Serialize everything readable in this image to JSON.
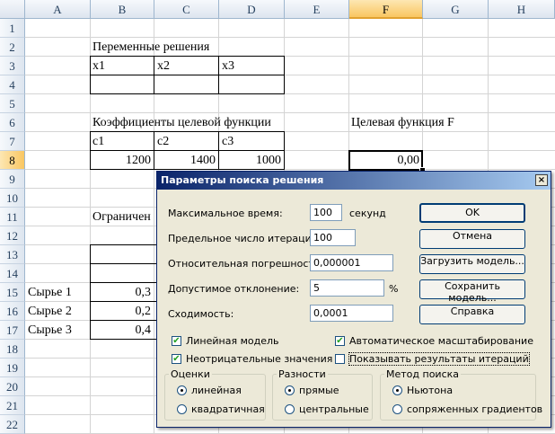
{
  "columns": [
    "A",
    "B",
    "C",
    "D",
    "E",
    "F",
    "G",
    "H"
  ],
  "rows": [
    "1",
    "2",
    "3",
    "4",
    "5",
    "6",
    "7",
    "8",
    "9",
    "10",
    "11",
    "12",
    "13",
    "14",
    "15",
    "16",
    "17",
    "18",
    "19",
    "20",
    "21",
    "22"
  ],
  "cells": {
    "b2": "Переменные решения",
    "b3": "x1",
    "c3": "x2",
    "d3": "x3",
    "b6": "Коэффициенты целевой функции",
    "f6": "Целевая функция F",
    "b7": "c1",
    "c7": "c2",
    "d7": "c3",
    "b8": "1200",
    "c8": "1400",
    "d8": "1000",
    "f8": "0,00",
    "b11": "Ограничен",
    "a15": "Сырье 1",
    "b15": "0,3",
    "a16": "Сырье 2",
    "b16": "0,2",
    "a17": "Сырье 3",
    "b17": "0,4"
  },
  "dialog": {
    "title": "Параметры поиска решения",
    "close_glyph": "×",
    "max_time_label": "Максимальное время:",
    "max_time_value": "100",
    "max_time_unit": "секунд",
    "iterations_label": "Предельное число итераций:",
    "iterations_value": "100",
    "precision_label": "Относительная погрешность:",
    "precision_value": "0,000001",
    "tolerance_label": "Допустимое отклонение:",
    "tolerance_value": "5",
    "tolerance_unit": "%",
    "convergence_label": "Сходимость:",
    "convergence_value": "0,0001",
    "buttons": {
      "ok": "OK",
      "cancel": "Отмена",
      "load": "Загрузить модель...",
      "save": "Сохранить модель...",
      "help": "Справка"
    },
    "checks": {
      "linear": "Линейная модель",
      "nonneg": "Неотрицательные значения",
      "autoscale": "Автоматическое масштабирование",
      "show_iter": "Показывать результаты итераций"
    },
    "estimates": {
      "title": "Оценки",
      "opt1": "линейная",
      "opt2": "квадратичная"
    },
    "derivatives": {
      "title": "Разности",
      "opt1": "прямые",
      "opt2": "центральные"
    },
    "search": {
      "title": "Метод поиска",
      "opt1": "Ньютона",
      "opt2": "сопряженных градиентов"
    }
  }
}
